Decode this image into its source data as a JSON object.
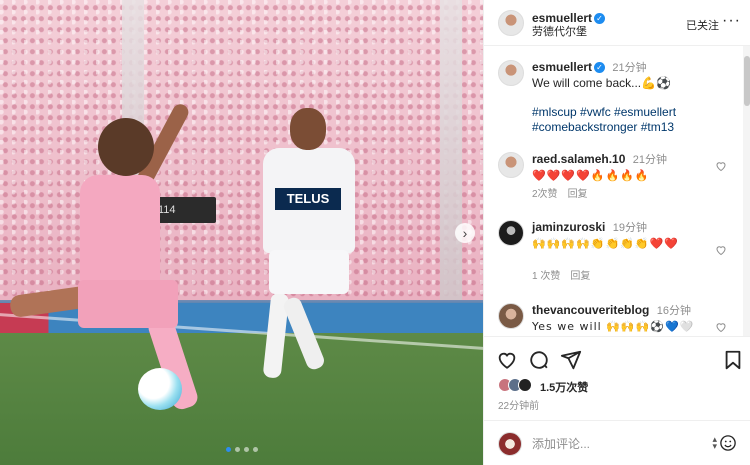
{
  "photo": {
    "scoreboard_text": "114",
    "dots_count": 4,
    "active_dot": 0
  },
  "header": {
    "username": "esmuellert",
    "location": "劳德代尔堡",
    "follow_label": "已关注",
    "more_label": "···"
  },
  "caption": {
    "username": "esmuellert",
    "time": "21分钟",
    "text": "We will come back...💪⚽",
    "hashtags_line1": "#mlscup #vwfc #esmuellert",
    "hashtags_line2": "#comebackstronger #tm13"
  },
  "comments": [
    {
      "username": "raed.salameh.10",
      "time": "21分钟",
      "text": "❤️❤️❤️❤️🔥🔥🔥🔥",
      "likes": "2次赞",
      "reply": "回复"
    },
    {
      "username": "jaminzuroski",
      "time": "19分钟",
      "text": "🙌🙌🙌🙌👏👏👏👏❤️❤️",
      "likes": "1 次赞",
      "reply": "回复"
    },
    {
      "username": "thevancouveriteblog",
      "time": "16分钟",
      "text": "Yes we will 🙌🙌🙌⚽💙🤍",
      "likes": "",
      "reply": ""
    }
  ],
  "actions": {
    "likes": "1.5万次赞",
    "posted": "22分钟前"
  },
  "composer": {
    "placeholder": "添加评论..."
  },
  "colors": {
    "link": "#00376b",
    "verified": "#1d8cf0",
    "secondary_text": "#8e8e8e"
  }
}
